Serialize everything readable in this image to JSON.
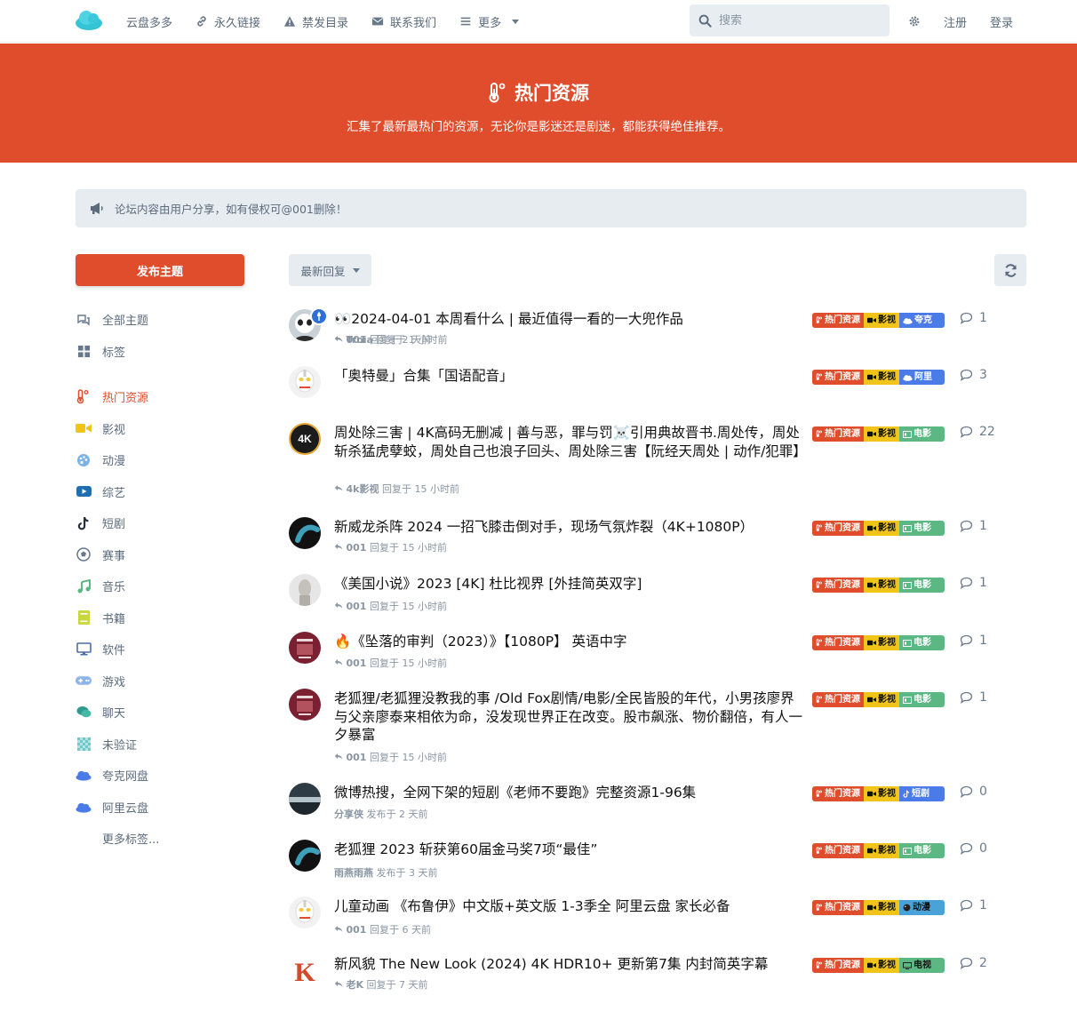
{
  "nav": {
    "items": [
      {
        "label": "云盘多多",
        "icon": ""
      },
      {
        "label": "永久链接",
        "icon": "link-icon"
      },
      {
        "label": "禁发目录",
        "icon": "warning-icon"
      },
      {
        "label": "联系我们",
        "icon": "envelope-icon"
      },
      {
        "label": "更多",
        "icon": "bars-icon"
      }
    ],
    "search_placeholder": "搜索",
    "register": "注册",
    "login": "登录"
  },
  "hero": {
    "title": "热门资源",
    "description": "汇集了最新最热门的资源，无论你是影迷还是剧迷，都能获得绝佳推荐。",
    "color": "#e04d2c"
  },
  "notice": "论坛内容由用户分享，如有侵权可@001删除！",
  "sidebar": {
    "post_button": "发布主题",
    "items": [
      {
        "label": "全部主题",
        "icon": "comments-icon"
      },
      {
        "label": "标签",
        "icon": "grid-icon"
      },
      {
        "label": "热门资源",
        "icon": "thermometer-icon",
        "active": true
      },
      {
        "label": "影视",
        "icon": "video-camera-icon"
      },
      {
        "label": "动漫",
        "icon": "palette-icon"
      },
      {
        "label": "综艺",
        "icon": "youtube-icon"
      },
      {
        "label": "短剧",
        "icon": "tiktok-icon"
      },
      {
        "label": "赛事",
        "icon": "soccer-ball-icon"
      },
      {
        "label": "音乐",
        "icon": "music-icon"
      },
      {
        "label": "书籍",
        "icon": "book-icon"
      },
      {
        "label": "软件",
        "icon": "desktop-icon"
      },
      {
        "label": "游戏",
        "icon": "gamepad-icon"
      },
      {
        "label": "聊天",
        "icon": "chat-icon"
      },
      {
        "label": "未验证",
        "icon": "checker-icon"
      },
      {
        "label": "夸克网盘",
        "icon": "cloud-icon"
      },
      {
        "label": "阿里云盘",
        "icon": "cloud-icon"
      },
      {
        "label": "更多标签...",
        "icon": ""
      }
    ]
  },
  "toolbar": {
    "sort_label": "最新回复"
  },
  "discussions": [
    {
      "title": "👀2024-04-01 本周看什么 | 最近值得一看的一大兜作品",
      "user": "001",
      "action": "回复于 2 天前",
      "reply_icon": true,
      "tags": [
        "热门资源",
        "影视",
        "夸克"
      ],
      "tag3_color": "#4a7be8",
      "tag3_icon": "cloud",
      "replies": "1",
      "avatar": "panda"
    },
    {
      "title": "「奥特曼」合集「国语配音」",
      "user": "Troia",
      "action": "回复于 1 小时前",
      "reply_icon": true,
      "tags": [
        "热门资源",
        "影视",
        "阿里"
      ],
      "tag3_color": "#4a7be8",
      "tag3_icon": "cloud",
      "replies": "3",
      "avatar": "ultra"
    },
    {
      "title": "周处除三害 | 4K高码无删减 | 善与恶，罪与罚☠️引用典故晋书.周处传，周处斩杀猛虎孽蛟，周处自己也浪子回头、周处除三害【阮经天周处 | 动作/犯罪】",
      "user": "4k影视",
      "action": "回复于 15 小时前",
      "reply_icon": true,
      "tags": [
        "热门资源",
        "影视",
        "电影"
      ],
      "tag3_color": "#5cb883",
      "tag3_icon": "film",
      "replies": "22",
      "avatar": "4k"
    },
    {
      "title": "新威龙杀阵 2024 一招飞膝击倒对手，现场气氛炸裂（4K+1080P）",
      "user": "001",
      "action": "回复于 15 小时前",
      "reply_icon": true,
      "tags": [
        "热门资源",
        "影视",
        "电影"
      ],
      "tag3_color": "#5cb883",
      "tag3_icon": "film",
      "replies": "1",
      "avatar": "dark"
    },
    {
      "title": "《美国小说》2023 [4K] 杜比视界 [外挂简英双字]",
      "user": "001",
      "action": "回复于 15 小时前",
      "reply_icon": true,
      "tags": [
        "热门资源",
        "影视",
        "电影"
      ],
      "tag3_color": "#5cb883",
      "tag3_icon": "film",
      "replies": "1",
      "avatar": "statue"
    },
    {
      "title": "🔥《坠落的审判（2023）》【1080P】 英语中字",
      "user": "001",
      "action": "回复于 15 小时前",
      "reply_icon": true,
      "tags": [
        "热门资源",
        "影视",
        "电影"
      ],
      "tag3_color": "#5cb883",
      "tag3_icon": "film",
      "replies": "1",
      "avatar": "poster"
    },
    {
      "title": "老狐狸/老狐狸没教我的事 /Old Fox剧情/电影/全民皆股的年代，小男孩廖界与父亲廖泰来相依为命，没发现世界正在改变。股市飙涨、物价翻倍，有人一夕暴富",
      "user": "001",
      "action": "回复于 15 小时前",
      "reply_icon": true,
      "tags": [
        "热门资源",
        "影视",
        "电影"
      ],
      "tag3_color": "#5cb883",
      "tag3_icon": "film",
      "replies": "1",
      "avatar": "poster"
    },
    {
      "title": "微博热搜，全网下架的短剧《老师不要跑》完整资源1-96集",
      "user": "分享侠",
      "action": "发布于 2 天前",
      "reply_icon": false,
      "tags": [
        "热门资源",
        "影视",
        "短剧"
      ],
      "tag3_color": "#4a7be8",
      "tag3_icon": "tiktok",
      "replies": "0",
      "avatar": "landscape"
    },
    {
      "title": "老狐狸 2023 斩获第60届金马奖7项“最佳”",
      "user": "雨燕雨燕",
      "action": "发布于 3 天前",
      "reply_icon": false,
      "tags": [
        "热门资源",
        "影视",
        "电影"
      ],
      "tag3_color": "#5cb883",
      "tag3_icon": "film",
      "replies": "0",
      "avatar": "dark"
    },
    {
      "title": "儿童动画 《布鲁伊》中文版+英文版 1-3季全 阿里云盘 家长必备",
      "user": "001",
      "action": "回复于 6 天前",
      "reply_icon": true,
      "tags": [
        "热门资源",
        "影视",
        "动漫"
      ],
      "tag3_color": "#4aa3d8",
      "tag3_icon": "palette",
      "replies": "1",
      "avatar": "ultra"
    },
    {
      "title": "新风貌 The New Look (2024) 4K HDR10+ 更新第7集 内封简英字幕",
      "user": "老K",
      "action": "回复于 7 天前",
      "reply_icon": true,
      "tags": [
        "热门资源",
        "影视",
        "电视"
      ],
      "tag3_color": "#5cb883",
      "tag3_icon": "tv",
      "replies": "2",
      "avatar": "k"
    }
  ]
}
